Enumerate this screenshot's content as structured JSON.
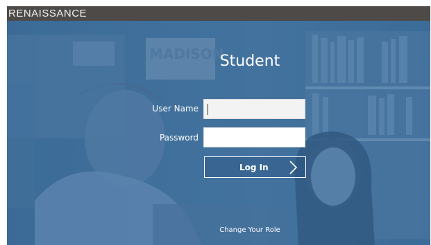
{
  "header": {
    "brand": "RENAISSANCE"
  },
  "login": {
    "role_title": "Student",
    "username_label": "User Name",
    "username_value": "",
    "password_label": "Password",
    "password_value": "",
    "login_button": "Log In",
    "change_role": "Change Your Role"
  },
  "background": {
    "poster_text": "MADISON"
  },
  "colors": {
    "topbar": "#4d4a48",
    "overlay_blue": "#3f6f9a",
    "text": "#ffffff"
  }
}
